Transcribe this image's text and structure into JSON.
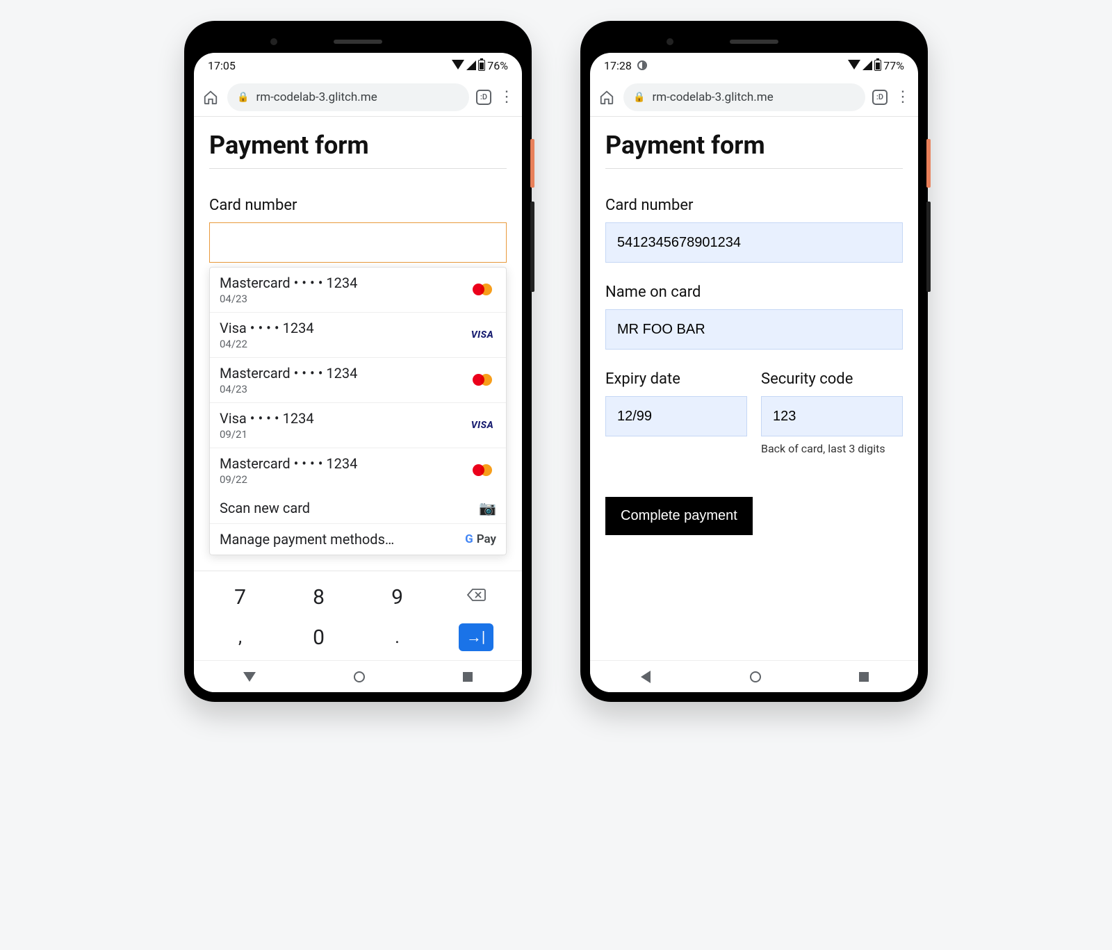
{
  "phoneA": {
    "status": {
      "time": "17:05",
      "battery": "76%"
    },
    "chrome": {
      "url": "rm-codelab-3.glitch.me",
      "tabs": ":D"
    },
    "page": {
      "title": "Payment form",
      "card_number_label": "Card number"
    },
    "autofill": {
      "items": [
        {
          "brand": "Mastercard",
          "last4": "• • • • 1234",
          "exp": "04/23",
          "logo": "mastercard"
        },
        {
          "brand": "Visa",
          "last4": "• • • • 1234",
          "exp": "04/22",
          "logo": "visa"
        },
        {
          "brand": "Mastercard",
          "last4": "• • • • 1234",
          "exp": "04/23",
          "logo": "mastercard"
        },
        {
          "brand": "Visa",
          "last4": "• • • • 1234",
          "exp": "09/21",
          "logo": "visa"
        },
        {
          "brand": "Mastercard",
          "last4": "• • • • 1234",
          "exp": "09/22",
          "logo": "mastercard"
        }
      ],
      "scan_label": "Scan new card",
      "manage_label": "Manage payment methods…",
      "gpay_label": "Pay"
    },
    "keyboard": {
      "row1": [
        "7",
        "8",
        "9"
      ],
      "row2_comma": ",",
      "row2_zero": "0",
      "row2_dot": "."
    }
  },
  "phoneB": {
    "status": {
      "time": "17:28",
      "battery": "77%"
    },
    "chrome": {
      "url": "rm-codelab-3.glitch.me",
      "tabs": ":D"
    },
    "page": {
      "title": "Payment form",
      "card_number_label": "Card number",
      "card_number_value": "5412345678901234",
      "name_label": "Name on card",
      "name_value": "MR FOO BAR",
      "expiry_label": "Expiry date",
      "expiry_value": "12/99",
      "cvc_label": "Security code",
      "cvc_value": "123",
      "cvc_hint": "Back of card, last 3 digits",
      "submit_label": "Complete payment"
    }
  }
}
